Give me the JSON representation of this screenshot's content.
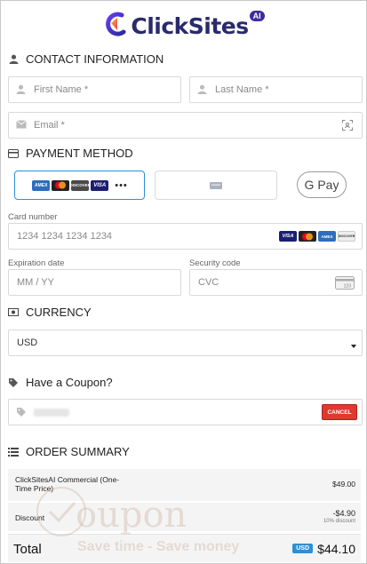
{
  "brand": {
    "name": "ClickSites",
    "badge": "AI"
  },
  "contact": {
    "title": "CONTACT INFORMATION",
    "first_name_placeholder": "First Name *",
    "last_name_placeholder": "Last Name *",
    "email_placeholder": "Email *"
  },
  "payment": {
    "title": "PAYMENT METHOD",
    "more_dots": "•••",
    "gpay_label": "G Pay",
    "card_number_label": "Card number",
    "card_number_placeholder": "1234 1234 1234 1234",
    "expiration_label": "Expiration date",
    "expiration_placeholder": "MM / YY",
    "security_label": "Security code",
    "security_placeholder": "CVC",
    "cvc_icon_text": "123",
    "card_brands": [
      "VISA",
      "MC",
      "AMEX",
      "DISCOVER"
    ]
  },
  "currency": {
    "title": "CURRENCY",
    "selected": "USD"
  },
  "coupon": {
    "title": "Have a Coupon?",
    "cancel_label": "CANCEL"
  },
  "summary": {
    "title": "ORDER SUMMARY",
    "item_name": "ClickSitesAI Commercial (One-Time Price)",
    "item_price": "$49.00",
    "discount_label": "Discount",
    "discount_value": "-$4.90",
    "discount_note": "10% discount",
    "total_label": "Total",
    "currency_badge": "USD",
    "total_value": "$44.10"
  },
  "watermark": {
    "word": "oupon",
    "tagline": "Save time - Save money"
  },
  "colors": {
    "accent_blue": "#2f8fd6",
    "cancel_red": "#e0392f",
    "logo_navy": "#2a2a6e"
  }
}
